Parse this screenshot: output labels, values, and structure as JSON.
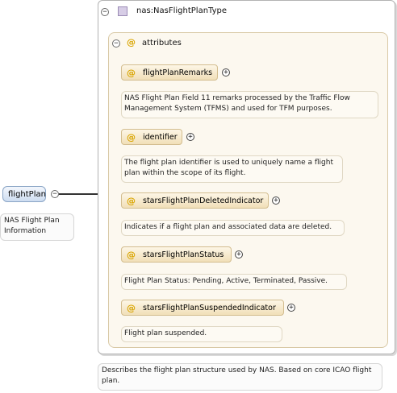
{
  "root": {
    "name": "flightPlan",
    "documentation": "NAS Flight Plan Information"
  },
  "type": {
    "name": "nas:NasFlightPlanType",
    "documentation": "Describes the flight plan structure used by NAS. Based on core ICAO flight plan."
  },
  "attributes_group": {
    "label": "attributes",
    "items": [
      {
        "name": "flightPlanRemarks",
        "documentation": "NAS Flight Plan Field 11 remarks processed by the Traffic Flow Management System (TFMS) and used for TFM purposes."
      },
      {
        "name": "identifier",
        "documentation": "The flight plan identifier is used to uniquely name a flight plan within the scope of its flight."
      },
      {
        "name": "starsFlightPlanDeletedIndicator",
        "documentation": "Indicates if a flight plan and associated data are deleted."
      },
      {
        "name": "starsFlightPlanStatus",
        "documentation": "Flight Plan Status: Pending, Active, Terminated, Passive."
      },
      {
        "name": "starsFlightPlanSuspendedIndicator",
        "documentation": "Flight plan suspended."
      }
    ]
  },
  "symbols": {
    "collapse": "−",
    "expand": "+",
    "attribute": "@"
  }
}
